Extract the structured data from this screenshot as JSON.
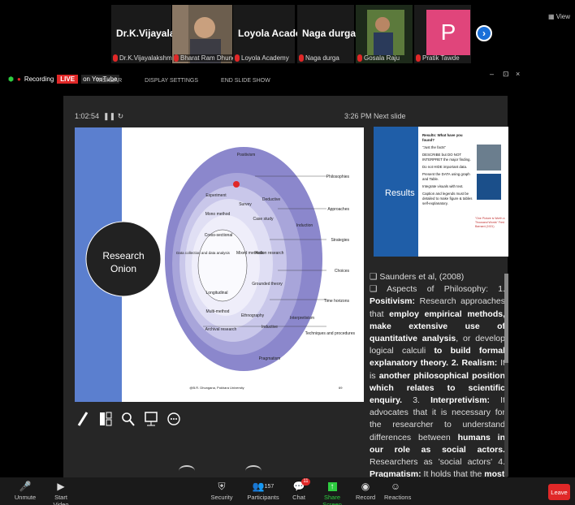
{
  "participants": [
    {
      "display": "Dr.K.Vijayalaksh...",
      "label": "Dr.K.Vijayalakshmi"
    },
    {
      "display": "",
      "label": "Bharat Ram Dhungana"
    },
    {
      "display": "Loyola Academy",
      "label": "Loyola Academy"
    },
    {
      "display": "Naga durga",
      "label": "Naga durga"
    },
    {
      "display": "",
      "label": "Gosala Raju"
    },
    {
      "display": "P",
      "label": "Pratik Tawde"
    }
  ],
  "view_label": "View",
  "recording": {
    "label": "Recording",
    "live": "LIVE",
    "platform": "on YouTube"
  },
  "presenter_toolbar": {
    "taskbar": "TASKBAR",
    "display_settings": "DISPLAY SETTINGS",
    "end_show": "END SLIDE SHOW"
  },
  "window_controls": {
    "minimize": "–",
    "restore": "⊡",
    "close": "×"
  },
  "timer": "1:02:54",
  "clock": "3:26 PM",
  "next_slide_label": "Next slide",
  "slide": {
    "title_line1": "Research",
    "title_line2": "Onion",
    "layers": [
      "Positivism",
      "Deductive",
      "Induction",
      "Interpretivism",
      "Inductive",
      "Pragmatism"
    ],
    "inner": [
      "Experiment",
      "Survey",
      "Mono method",
      "Case study",
      "Cross-sectional",
      "Mixed methods",
      "Action research",
      "Data collection and data analysis",
      "Grounded theory",
      "Longitudinal",
      "Multi-method",
      "Ethnography",
      "Archival research"
    ],
    "right_labels": [
      "Philosophies",
      "Approaches",
      "Strategies",
      "Choices",
      "Time horizons",
      "Techniques and procedures"
    ],
    "footer": "@B.R. Dhungana, Pokhara University",
    "page": "69"
  },
  "next_slide": {
    "title": "Results",
    "bullets": [
      "Results: What have you found?",
      "\"Just the facts\"",
      "DESCRIBE but DO NOT INTERPRET the major finding.",
      "Do not HIDE important data.",
      "Present the DATA using graph and Table.",
      "Integrate visuals with text.",
      "Caption and legends must be detailed to make figure & tables self-explanatory."
    ],
    "quote": "\"One Picture is Worth a Thousand Words\" Fred Barnard (1921)"
  },
  "notes": {
    "line1": "❑ Saunders et al, (2008)",
    "p_prefix": "❑ Aspects of Philosophy: 1. ",
    "positivism": "Positivism:",
    "t1": " Research approaches that ",
    "b1": "employ empirical methods, make extensive use of quantitative analysis",
    "t2": ", or develop logical calculi ",
    "b2": "to build formal explanatory theory. 2. Realism:",
    "t3": " It is ",
    "b3": "another philosophical position which relates to scientific enquiry.",
    "t4": " 3. ",
    "b4": "Interpretivism:",
    "t5": " It advocates that it is necessary for the researcher to understand differences between ",
    "b5": "humans in our role as social actors.",
    "t6": " Researchers as 'social actors' 4. ",
    "b6": "Pragmatism:",
    "t7": " It holds that the ",
    "b7": "most"
  },
  "bottom": {
    "unmute": "Unmute",
    "start_video": "Start Video",
    "security": "Security",
    "participants": "Participants",
    "participant_count": "157",
    "chat": "Chat",
    "chat_badge": "11",
    "share_screen": "Share Screen",
    "record": "Record",
    "reactions": "Reactions",
    "leave": "Leave"
  },
  "colors": {
    "share_green": "#2ecc40",
    "accent_red": "#e02828",
    "slide_blue": "#1f5ea8",
    "onion_purple": "#8b87cc"
  }
}
